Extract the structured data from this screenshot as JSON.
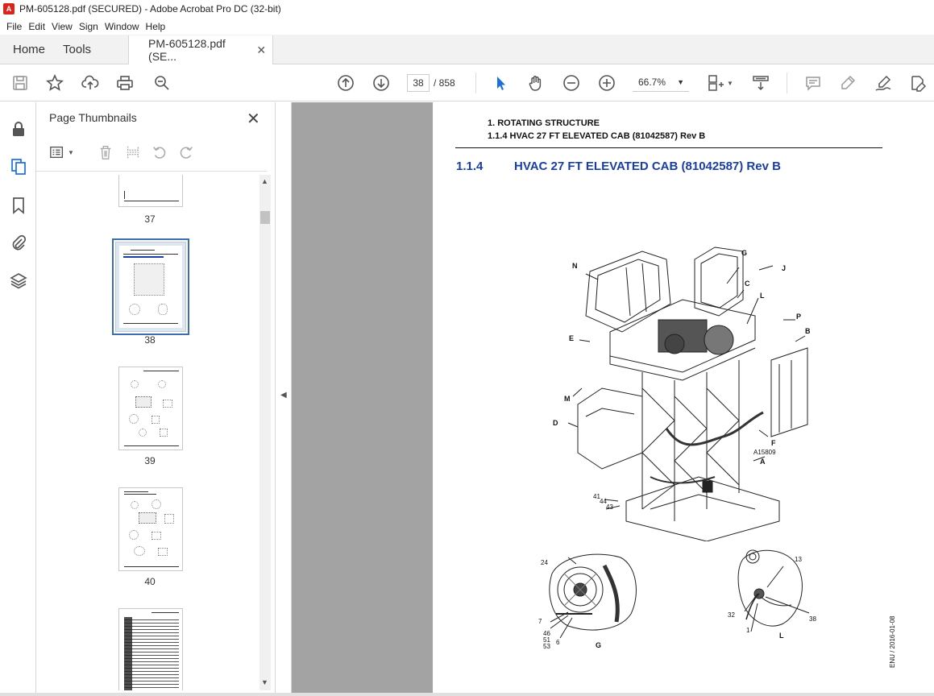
{
  "window": {
    "title": "PM-605128.pdf (SECURED) - Adobe Acrobat Pro DC (32-bit)"
  },
  "menu": [
    "File",
    "Edit",
    "View",
    "Sign",
    "Window",
    "Help"
  ],
  "tabs": {
    "home": "Home",
    "tools": "Tools",
    "doc": "PM-605128.pdf (SE..."
  },
  "toolbar": {
    "page_current": "38",
    "page_total": "/ 858",
    "zoom": "66.7%"
  },
  "thumbnails": {
    "title": "Page Thumbnails",
    "pages": [
      "37",
      "38",
      "39",
      "40"
    ]
  },
  "document": {
    "header_line1": "1. ROTATING STRUCTURE",
    "header_line2": "1.1.4 HVAC 27 FT ELEVATED CAB (81042587) Rev B",
    "section_number": "1.1.4",
    "section_title": "HVAC 27 FT ELEVATED CAB (81042587) Rev B",
    "callouts": {
      "N": "N",
      "G": "G",
      "J": "J",
      "C": "C",
      "L": "L",
      "P": "P",
      "B": "B",
      "E": "E",
      "M": "M",
      "D": "D",
      "F": "F",
      "A": "A",
      "ref": "A15809",
      "n41": "41",
      "n44": "44",
      "n43": "43"
    },
    "detail_g": {
      "n24": "24",
      "n7": "7",
      "n46": "46",
      "n51": "51",
      "n53": "53",
      "n6": "6",
      "label": "G"
    },
    "detail_l": {
      "n13": "13",
      "n32": "32",
      "n1": "1",
      "n38": "38",
      "label": "L"
    },
    "side_note": "ENU / 2016-01-08"
  },
  "colors": {
    "accent": "#1a3ea8",
    "viewer_bg": "#a3a3a3",
    "selection": "#3d6db3"
  }
}
